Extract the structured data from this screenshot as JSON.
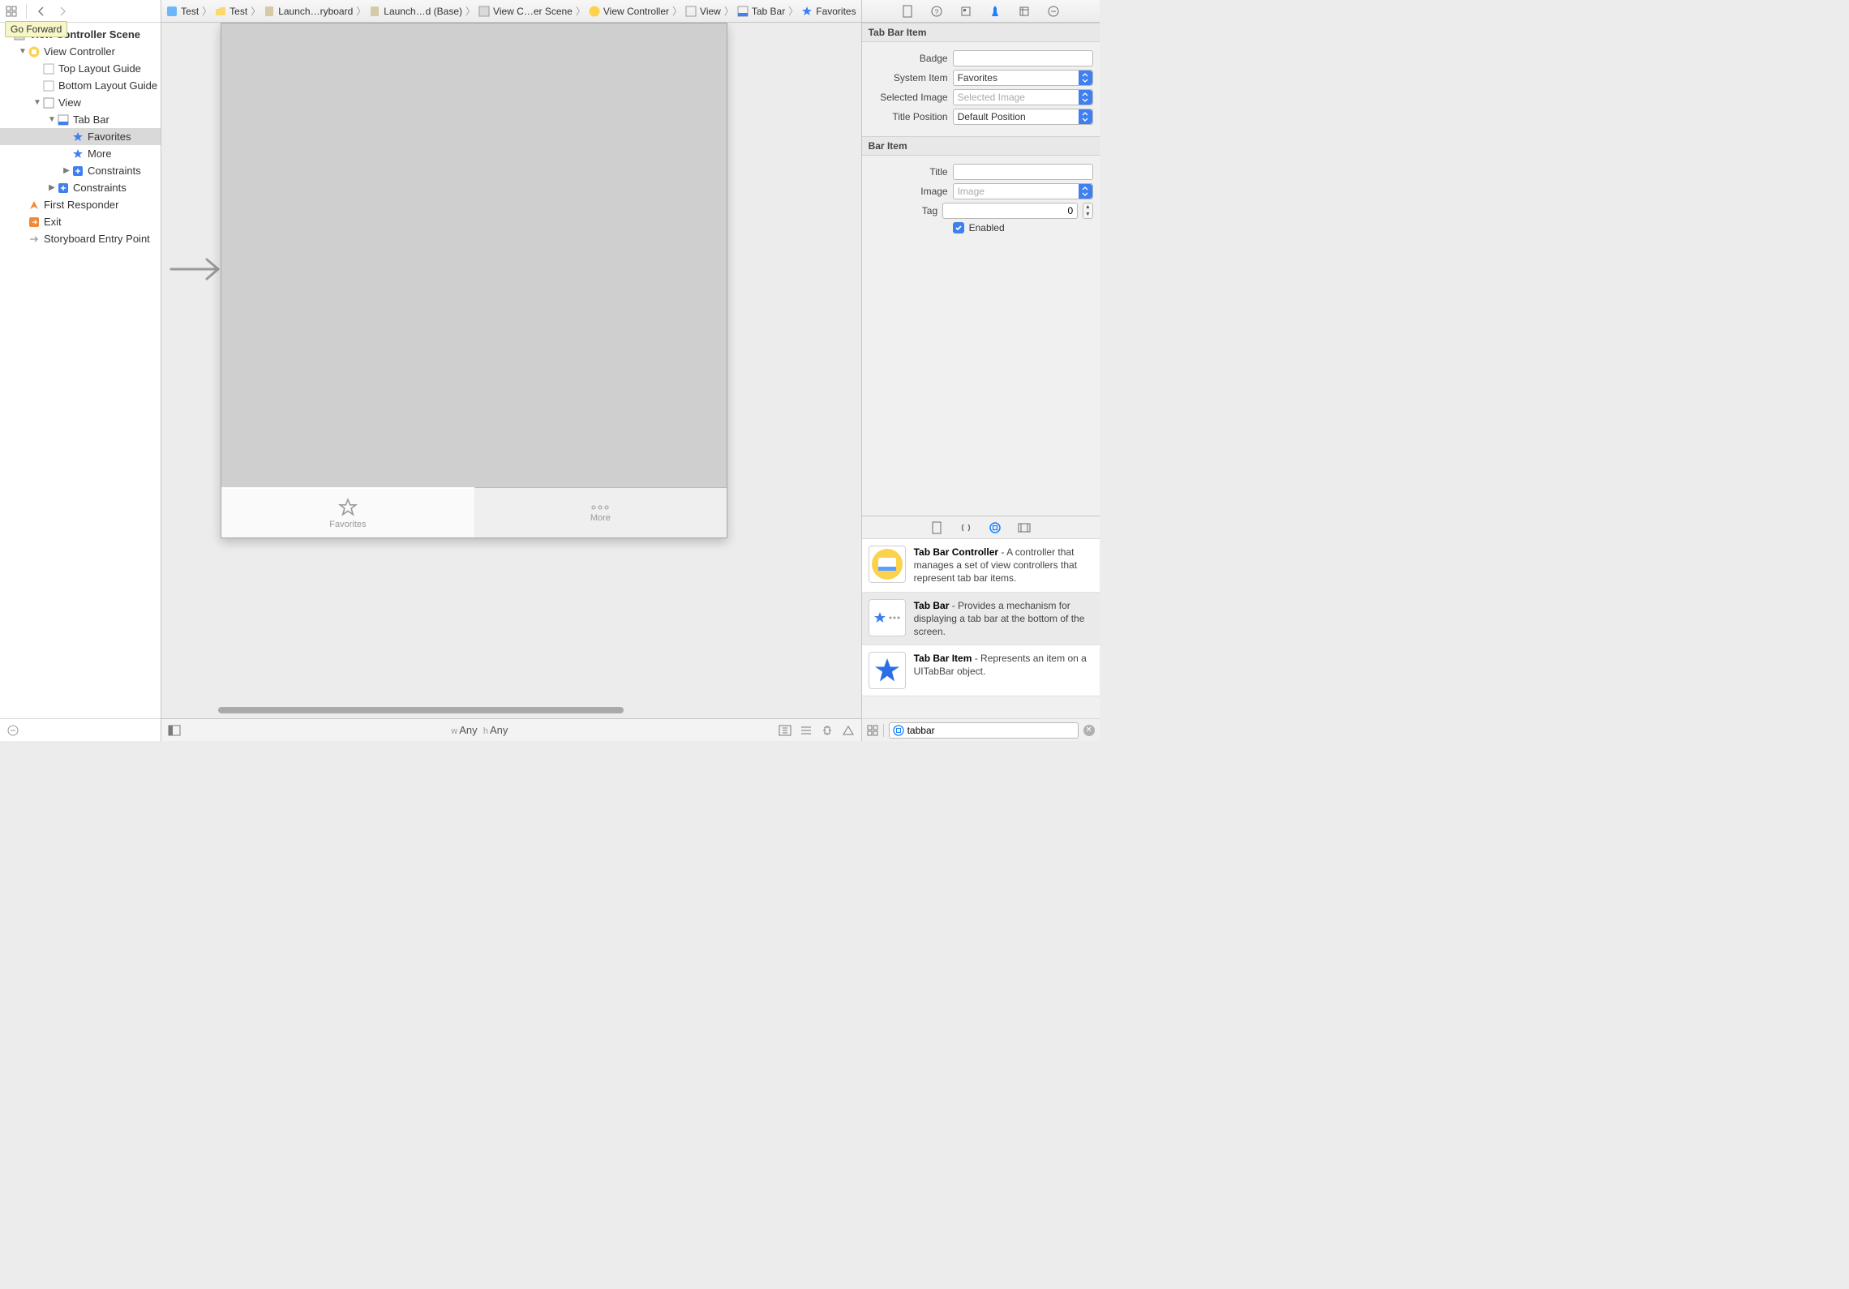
{
  "tooltip": "Go Forward",
  "jumpbar": {
    "items": [
      {
        "label": "Test",
        "icon": "blueprint"
      },
      {
        "label": "Test",
        "icon": "folder"
      },
      {
        "label": "Launch…ryboard",
        "icon": "storyboard"
      },
      {
        "label": "Launch…d (Base)",
        "icon": "storyboard"
      },
      {
        "label": "View C…er Scene",
        "icon": "scene"
      },
      {
        "label": "View Controller",
        "icon": "vc"
      },
      {
        "label": "View",
        "icon": "view"
      },
      {
        "label": "Tab Bar",
        "icon": "tabbar"
      },
      {
        "label": "Favorites",
        "icon": "star"
      }
    ]
  },
  "tree": {
    "scene_title": "View Controller Scene",
    "vc": "View Controller",
    "top_guide": "Top Layout Guide",
    "bottom_guide": "Bottom Layout Guide",
    "view": "View",
    "tabbar": "Tab Bar",
    "favorites": "Favorites",
    "more": "More",
    "constraints1": "Constraints",
    "constraints2": "Constraints",
    "first_responder": "First Responder",
    "exit": "Exit",
    "entry": "Storyboard Entry Point"
  },
  "canvas": {
    "tab_favorites": "Favorites",
    "tab_more": "More"
  },
  "editor_footer": {
    "w": "w",
    "wval": "Any",
    "h": "h",
    "hval": "Any"
  },
  "inspector": {
    "tabbaritem_header": "Tab Bar Item",
    "badge_label": "Badge",
    "badge_value": "",
    "system_item_label": "System Item",
    "system_item_value": "Favorites",
    "selected_image_label": "Selected Image",
    "selected_image_placeholder": "Selected Image",
    "title_position_label": "Title Position",
    "title_position_value": "Default Position",
    "baritem_header": "Bar Item",
    "title_label": "Title",
    "title_value": "",
    "image_label": "Image",
    "image_placeholder": "Image",
    "tag_label": "Tag",
    "tag_value": "0",
    "enabled_label": "Enabled"
  },
  "library": {
    "items": [
      {
        "title": "Tab Bar Controller",
        "desc": " - A controller that manages a set of view controllers that represent tab bar items.",
        "thumb": "tbc"
      },
      {
        "title": "Tab Bar",
        "desc": " - Provides a mechanism for displaying a tab bar at the bottom of the screen.",
        "thumb": "tb"
      },
      {
        "title": "Tab Bar Item",
        "desc": " - Represents an item on a UITabBar object.",
        "thumb": "star"
      }
    ],
    "search_value": "tabbar"
  }
}
